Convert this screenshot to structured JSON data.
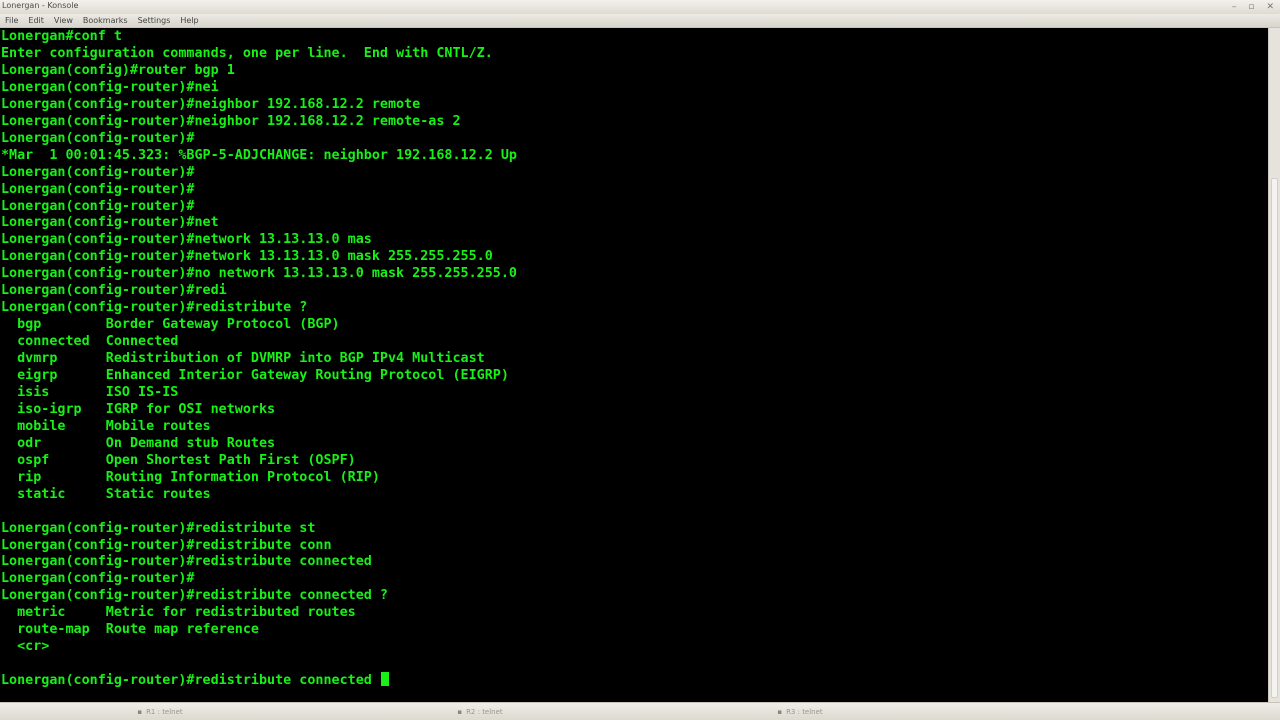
{
  "window": {
    "title": "Lonergan - Konsole",
    "controls": [
      "–",
      "▫",
      "✕"
    ]
  },
  "menubar": {
    "items": [
      "File",
      "Edit",
      "View",
      "Bookmarks",
      "Settings",
      "Help"
    ]
  },
  "terminal": {
    "text_color": "#18f018",
    "background": "#000000",
    "lines": [
      "Lonergan#conf t",
      "Enter configuration commands, one per line.  End with CNTL/Z.",
      "Lonergan(config)#router bgp 1",
      "Lonergan(config-router)#nei",
      "Lonergan(config-router)#neighbor 192.168.12.2 remote",
      "Lonergan(config-router)#neighbor 192.168.12.2 remote-as 2",
      "Lonergan(config-router)#",
      "*Mar  1 00:01:45.323: %BGP-5-ADJCHANGE: neighbor 192.168.12.2 Up",
      "Lonergan(config-router)#",
      "Lonergan(config-router)#",
      "Lonergan(config-router)#",
      "Lonergan(config-router)#net",
      "Lonergan(config-router)#network 13.13.13.0 mas",
      "Lonergan(config-router)#network 13.13.13.0 mask 255.255.255.0",
      "Lonergan(config-router)#no network 13.13.13.0 mask 255.255.255.0",
      "Lonergan(config-router)#redi",
      "Lonergan(config-router)#redistribute ?",
      "  bgp        Border Gateway Protocol (BGP)",
      "  connected  Connected",
      "  dvmrp      Redistribution of DVMRP into BGP IPv4 Multicast",
      "  eigrp      Enhanced Interior Gateway Routing Protocol (EIGRP)",
      "  isis       ISO IS-IS",
      "  iso-igrp   IGRP for OSI networks",
      "  mobile     Mobile routes",
      "  odr        On Demand stub Routes",
      "  ospf       Open Shortest Path First (OSPF)",
      "  rip        Routing Information Protocol (RIP)",
      "  static     Static routes",
      "",
      "Lonergan(config-router)#redistribute st",
      "Lonergan(config-router)#redistribute conn",
      "Lonergan(config-router)#redistribute connected",
      "Lonergan(config-router)#",
      "Lonergan(config-router)#redistribute connected ?",
      "  metric     Metric for redistributed routes",
      "  route-map  Route map reference",
      "  <cr>",
      "",
      "Lonergan(config-router)#redistribute connected "
    ]
  },
  "tabs": [
    {
      "label": "R1 : telnet"
    },
    {
      "label": "R2 : telnet"
    },
    {
      "label": "R3 : telnet"
    }
  ]
}
